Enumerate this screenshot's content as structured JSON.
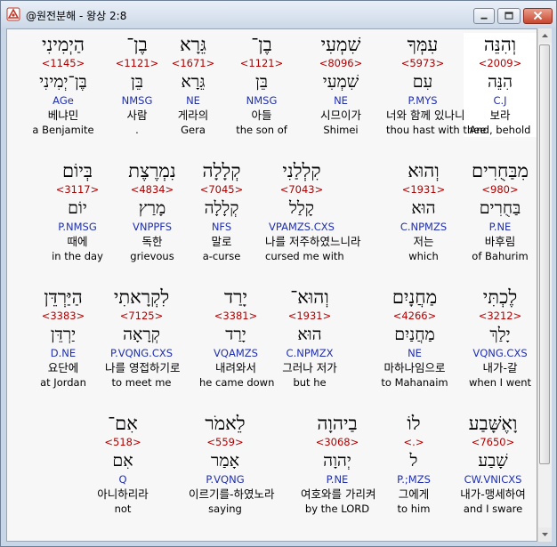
{
  "window": {
    "title": "@원전분해 - 왕상 2:8"
  },
  "rows": [
    {
      "words": [
        {
          "heb": "וְהִנֵּה",
          "num": "<2009>",
          "lex": "הִנֵּה",
          "morph": "C.J",
          "kor": "보라",
          "eng": "And, behold",
          "selected": true
        },
        {
          "heb": "עִמְּךָ",
          "num": "<5973>",
          "lex": "עִם",
          "morph": "P.MYS",
          "kor": "너와 함께 있나니",
          "eng": "thou hast with thee"
        },
        {
          "heb": "שִׁמְעִי",
          "num": "<8096>",
          "lex": "שִׁמְעִי",
          "morph": "NE",
          "kor": "시므이가",
          "eng": "Shimei"
        },
        {
          "heb": "בֶן־",
          "num": "<1121>",
          "lex": "בֵּן",
          "morph": "NMSG",
          "kor": "아들",
          "eng": "the son of"
        },
        {
          "heb": "גֵּרָא",
          "num": "<1671>",
          "lex": "גֵּרָא",
          "morph": "NE",
          "kor": "게라의",
          "eng": "Gera"
        },
        {
          "heb": "בֶן־",
          "num": "<1121>",
          "lex": "בֵּן",
          "morph": "NMSG",
          "kor": "사람",
          "eng": "."
        },
        {
          "heb": "הַיְמִינִי",
          "num": "<1145>",
          "lex": "בֶּן־יְמִינִי",
          "morph": "AGe",
          "kor": "베냐민",
          "eng": "a Benjamite"
        }
      ]
    },
    {
      "words": [
        {
          "heb": "מִבַּחֻרִים",
          "num": "<980>",
          "lex": "בַּחֻרִים",
          "morph": "P.NE",
          "kor": "바후림",
          "eng": "of Bahurim"
        },
        {
          "heb": "וְהוּא",
          "num": "<1931>",
          "lex": "הוּא",
          "morph": "C.NPMZS",
          "kor": "저는",
          "eng": "which"
        },
        {
          "heb": "קִלְלַנִי",
          "num": "<7043>",
          "lex": "קָלַל",
          "morph": "VPAMZS.CXS",
          "kor": "나를 저주하였느니라",
          "eng": "cursed me with"
        },
        {
          "heb": "קְלָלָה",
          "num": "<7045>",
          "lex": "קְלָלָה",
          "morph": "NFS",
          "kor": "말로",
          "eng": "a-curse"
        },
        {
          "heb": "נִמְרֶצֶת",
          "num": "<4834>",
          "lex": "מָרַץ",
          "morph": "VNPPFS",
          "kor": "독한",
          "eng": "grievous"
        },
        {
          "heb": "בְּיוֹם",
          "num": "<3117>",
          "lex": "יוֹם",
          "morph": "P.NMSG",
          "kor": "때에",
          "eng": "in the day"
        }
      ]
    },
    {
      "words": [
        {
          "heb": "לֶכְתִּי",
          "num": "<3212>",
          "lex": "יָלַךְ",
          "morph": "VQNG.CXS",
          "kor": "내가-갈",
          "eng": "when I went"
        },
        {
          "heb": "מַחֲנָיִם",
          "num": "<4266>",
          "lex": "מַחֲנַיִם",
          "morph": "NE",
          "kor": "마하나임으로",
          "eng": "to Mahanaim"
        },
        {
          "heb": "וְהוּא־",
          "num": "<1931>",
          "lex": "הוּא",
          "morph": "C.NPMZX",
          "kor": "그러나 저가",
          "eng": "but he"
        },
        {
          "heb": "יָרַד",
          "num": "<3381>",
          "lex": "יָרַד",
          "morph": "VQAMZS",
          "kor": "내려와서",
          "eng": "he came down"
        },
        {
          "heb": "לִקְרָאתִי",
          "num": "<7125>",
          "lex": "קְרָאָה",
          "morph": "P.VQNG.CXS",
          "kor": "나를 영접하기로",
          "eng": "to meet me"
        },
        {
          "heb": "הַיַּרְדֵּן",
          "num": "<3383>",
          "lex": "יַרְדֵּן",
          "morph": "D.NE",
          "kor": "요단에",
          "eng": "at Jordan"
        }
      ]
    },
    {
      "words": [
        {
          "heb": "וָאֶשָּׁבַע",
          "num": "<7650>",
          "lex": "שָׁבַע",
          "morph": "CW.VNICXS",
          "kor": "내가-맹세하여",
          "eng": "and I sware"
        },
        {
          "heb": "לוֹ",
          "num": "<.>",
          "lex": "ל",
          "morph": "P.;MZS",
          "kor": "그에게",
          "eng": "to him"
        },
        {
          "heb": "בַיהוָה",
          "num": "<3068>",
          "lex": "יְהוָה",
          "morph": "P.NE",
          "kor": "여호와를 가리켜",
          "eng": "by the LORD"
        },
        {
          "heb": "לֵאמֹר",
          "num": "<559>",
          "lex": "אָמַר",
          "morph": "P.VQNG",
          "kor": "이르기를-하였노라",
          "eng": "saying"
        },
        {
          "heb": "אִם־",
          "num": "<518>",
          "lex": "אִם",
          "morph": "Q",
          "kor": "아니하리라",
          "eng": "not"
        }
      ]
    }
  ]
}
